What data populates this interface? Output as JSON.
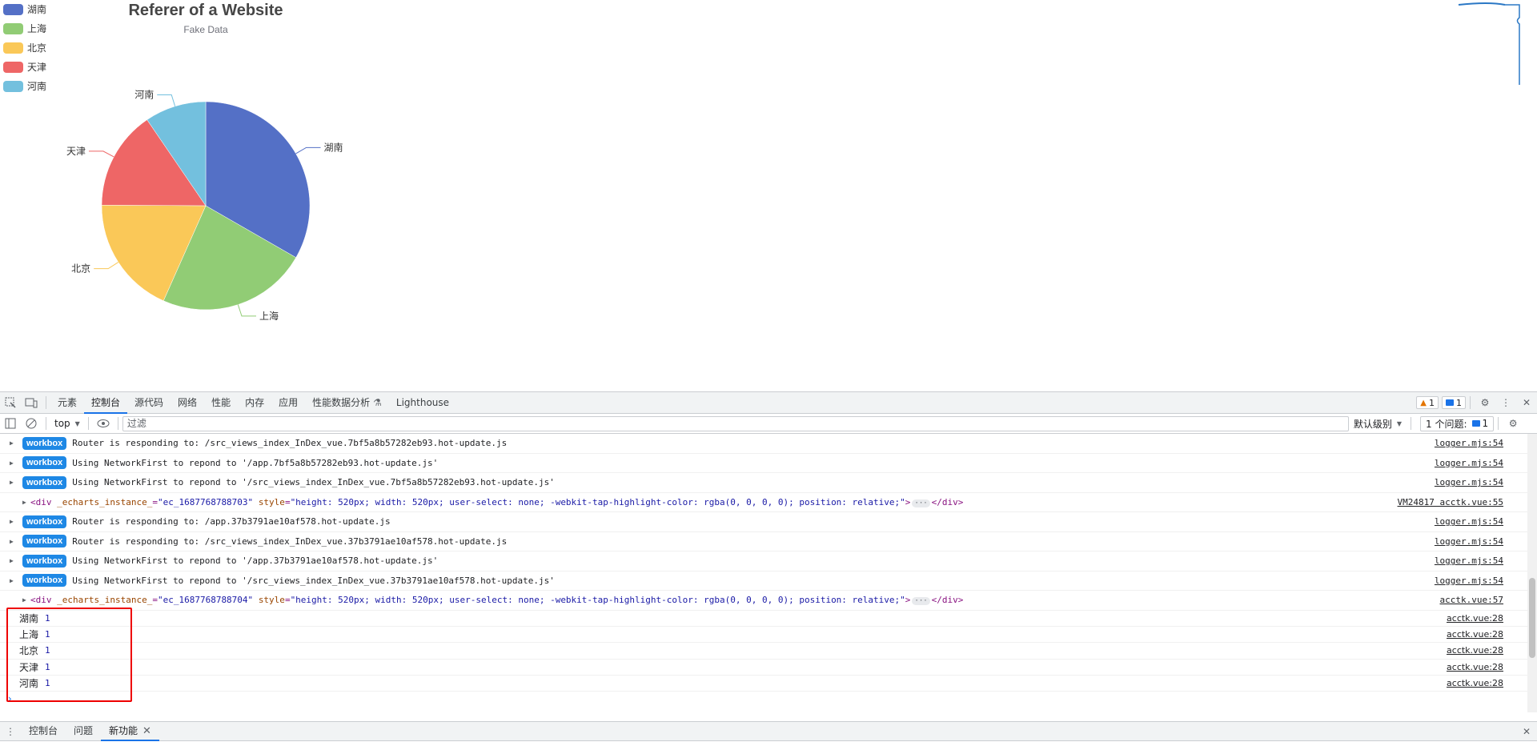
{
  "chart_data": {
    "type": "pie",
    "title": "Referer of a Website",
    "subtitle": "Fake Data",
    "legend_position": "top-left",
    "categories": [
      "湖南",
      "上海",
      "北京",
      "天津",
      "河南"
    ],
    "values": [
      1048,
      735,
      580,
      484,
      300
    ],
    "colors": [
      "#5470c6",
      "#91cc75",
      "#fac858",
      "#ee6666",
      "#73c0de"
    ]
  },
  "devtools": {
    "tabs": [
      "元素",
      "控制台",
      "源代码",
      "网络",
      "性能",
      "内存",
      "应用",
      "性能数据分析",
      "Lighthouse"
    ],
    "selected_tab": "控制台",
    "warning_count": "1",
    "message_count": "1",
    "context_selector": "top",
    "filter_placeholder": "过滤",
    "levels_label": "默认级别",
    "issues_label": "1 个问题:",
    "issues_count": "1",
    "console_logs": [
      {
        "badge": "workbox",
        "text": "Router is responding to: /src_views_index_InDex_vue.7bf5a8b57282eb93.hot-update.js",
        "source": "logger.mjs:54"
      },
      {
        "badge": "workbox",
        "text": "Using NetworkFirst to repond to  '/app.7bf5a8b57282eb93.hot-update.js'",
        "source": "logger.mjs:54"
      },
      {
        "badge": "workbox",
        "text": "Using NetworkFirst to repond to  '/src_views_index_InDex_vue.7bf5a8b57282eb93.hot-update.js'",
        "source": "logger.mjs:54"
      },
      {
        "div": true,
        "instance": "\"ec_1687768788703\"",
        "style": "\"height: 520px; width: 520px; user-select: none; -webkit-tap-highlight-color: rgba(0, 0, 0, 0); position: relative;\"",
        "source": "VM24817 acctk.vue:55"
      },
      {
        "badge": "workbox",
        "text": "Router is responding to: /app.37b3791ae10af578.hot-update.js",
        "source": "logger.mjs:54"
      },
      {
        "badge": "workbox",
        "text": "Router is responding to: /src_views_index_InDex_vue.37b3791ae10af578.hot-update.js",
        "source": "logger.mjs:54"
      },
      {
        "badge": "workbox",
        "text": "Using NetworkFirst to repond to  '/app.37b3791ae10af578.hot-update.js'",
        "source": "logger.mjs:54"
      },
      {
        "badge": "workbox",
        "text": "Using NetworkFirst to repond to  '/src_views_index_InDex_vue.37b3791ae10af578.hot-update.js'",
        "source": "logger.mjs:54"
      },
      {
        "div": true,
        "instance": "\"ec_1687768788704\"",
        "style": "\"height: 520px; width: 520px; user-select: none; -webkit-tap-highlight-color: rgba(0, 0, 0, 0); position: relative;\"",
        "source": "acctk.vue:57"
      }
    ],
    "value_logs": [
      {
        "key": "湖南",
        "value": "1",
        "source": "acctk.vue:28"
      },
      {
        "key": "上海",
        "value": "1",
        "source": "acctk.vue:28"
      },
      {
        "key": "北京",
        "value": "1",
        "source": "acctk.vue:28"
      },
      {
        "key": "天津",
        "value": "1",
        "source": "acctk.vue:28"
      },
      {
        "key": "河南",
        "value": "1",
        "source": "acctk.vue:28"
      }
    ],
    "prompt": "›",
    "drawer_tabs": [
      "控制台",
      "问题",
      "新功能"
    ],
    "drawer_selected": "新功能"
  }
}
